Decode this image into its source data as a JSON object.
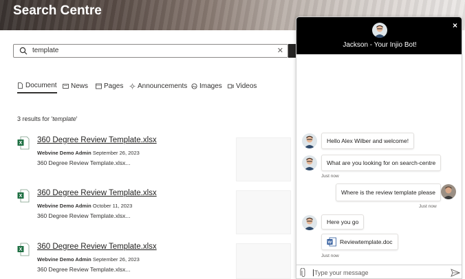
{
  "header": {
    "title": "Search Centre"
  },
  "search": {
    "query": "template"
  },
  "tabs": [
    {
      "label": "Document",
      "icon": "document-icon",
      "active": true
    },
    {
      "label": "News",
      "icon": "news-icon"
    },
    {
      "label": "Pages",
      "icon": "pages-icon"
    },
    {
      "label": "Announcements",
      "icon": "announcements-icon"
    },
    {
      "label": "Images",
      "icon": "images-icon"
    },
    {
      "label": "Videos",
      "icon": "videos-icon"
    }
  ],
  "results_summary": {
    "prefix": "3 results for '",
    "term": "template",
    "suffix": "'"
  },
  "results": [
    {
      "title": "360 Degree Review Template.xlsx",
      "author": "Webvine Demo Admin",
      "date": "September 26, 2023",
      "snippet": "360 Degree Review Template.xlsx..."
    },
    {
      "title": "360 Degree Review Template.xlsx",
      "author": "Webvine Demo Admin",
      "date": "October 11, 2023",
      "snippet": "360 Degree Review Template.xlsx..."
    },
    {
      "title": "360 Degree Review Template.xlsx",
      "author": "Webvine Demo Admin",
      "date": "September 26, 2023",
      "snippet": "360 Degree Review Template.xlsx..."
    }
  ],
  "chat": {
    "title": "Jackson - Your Injio Bot!",
    "close_label": "×",
    "messages": [
      {
        "from": "bot",
        "text": "Hello Alex Wilber and welcome!"
      },
      {
        "from": "bot",
        "text": "What are you looking for on search-centre",
        "time": "Just now"
      },
      {
        "from": "user",
        "text": "Where is the review template please",
        "time": "Just now"
      },
      {
        "from": "bot",
        "text": "Here you go"
      },
      {
        "from": "bot",
        "attachment": "Reviewtemplate.doc",
        "time": "Just now"
      }
    ],
    "input_placeholder": "Type your message"
  },
  "colors": {
    "excel_green": "#1d6f42",
    "word_blue": "#2b579a",
    "chat_header": "#000000"
  }
}
